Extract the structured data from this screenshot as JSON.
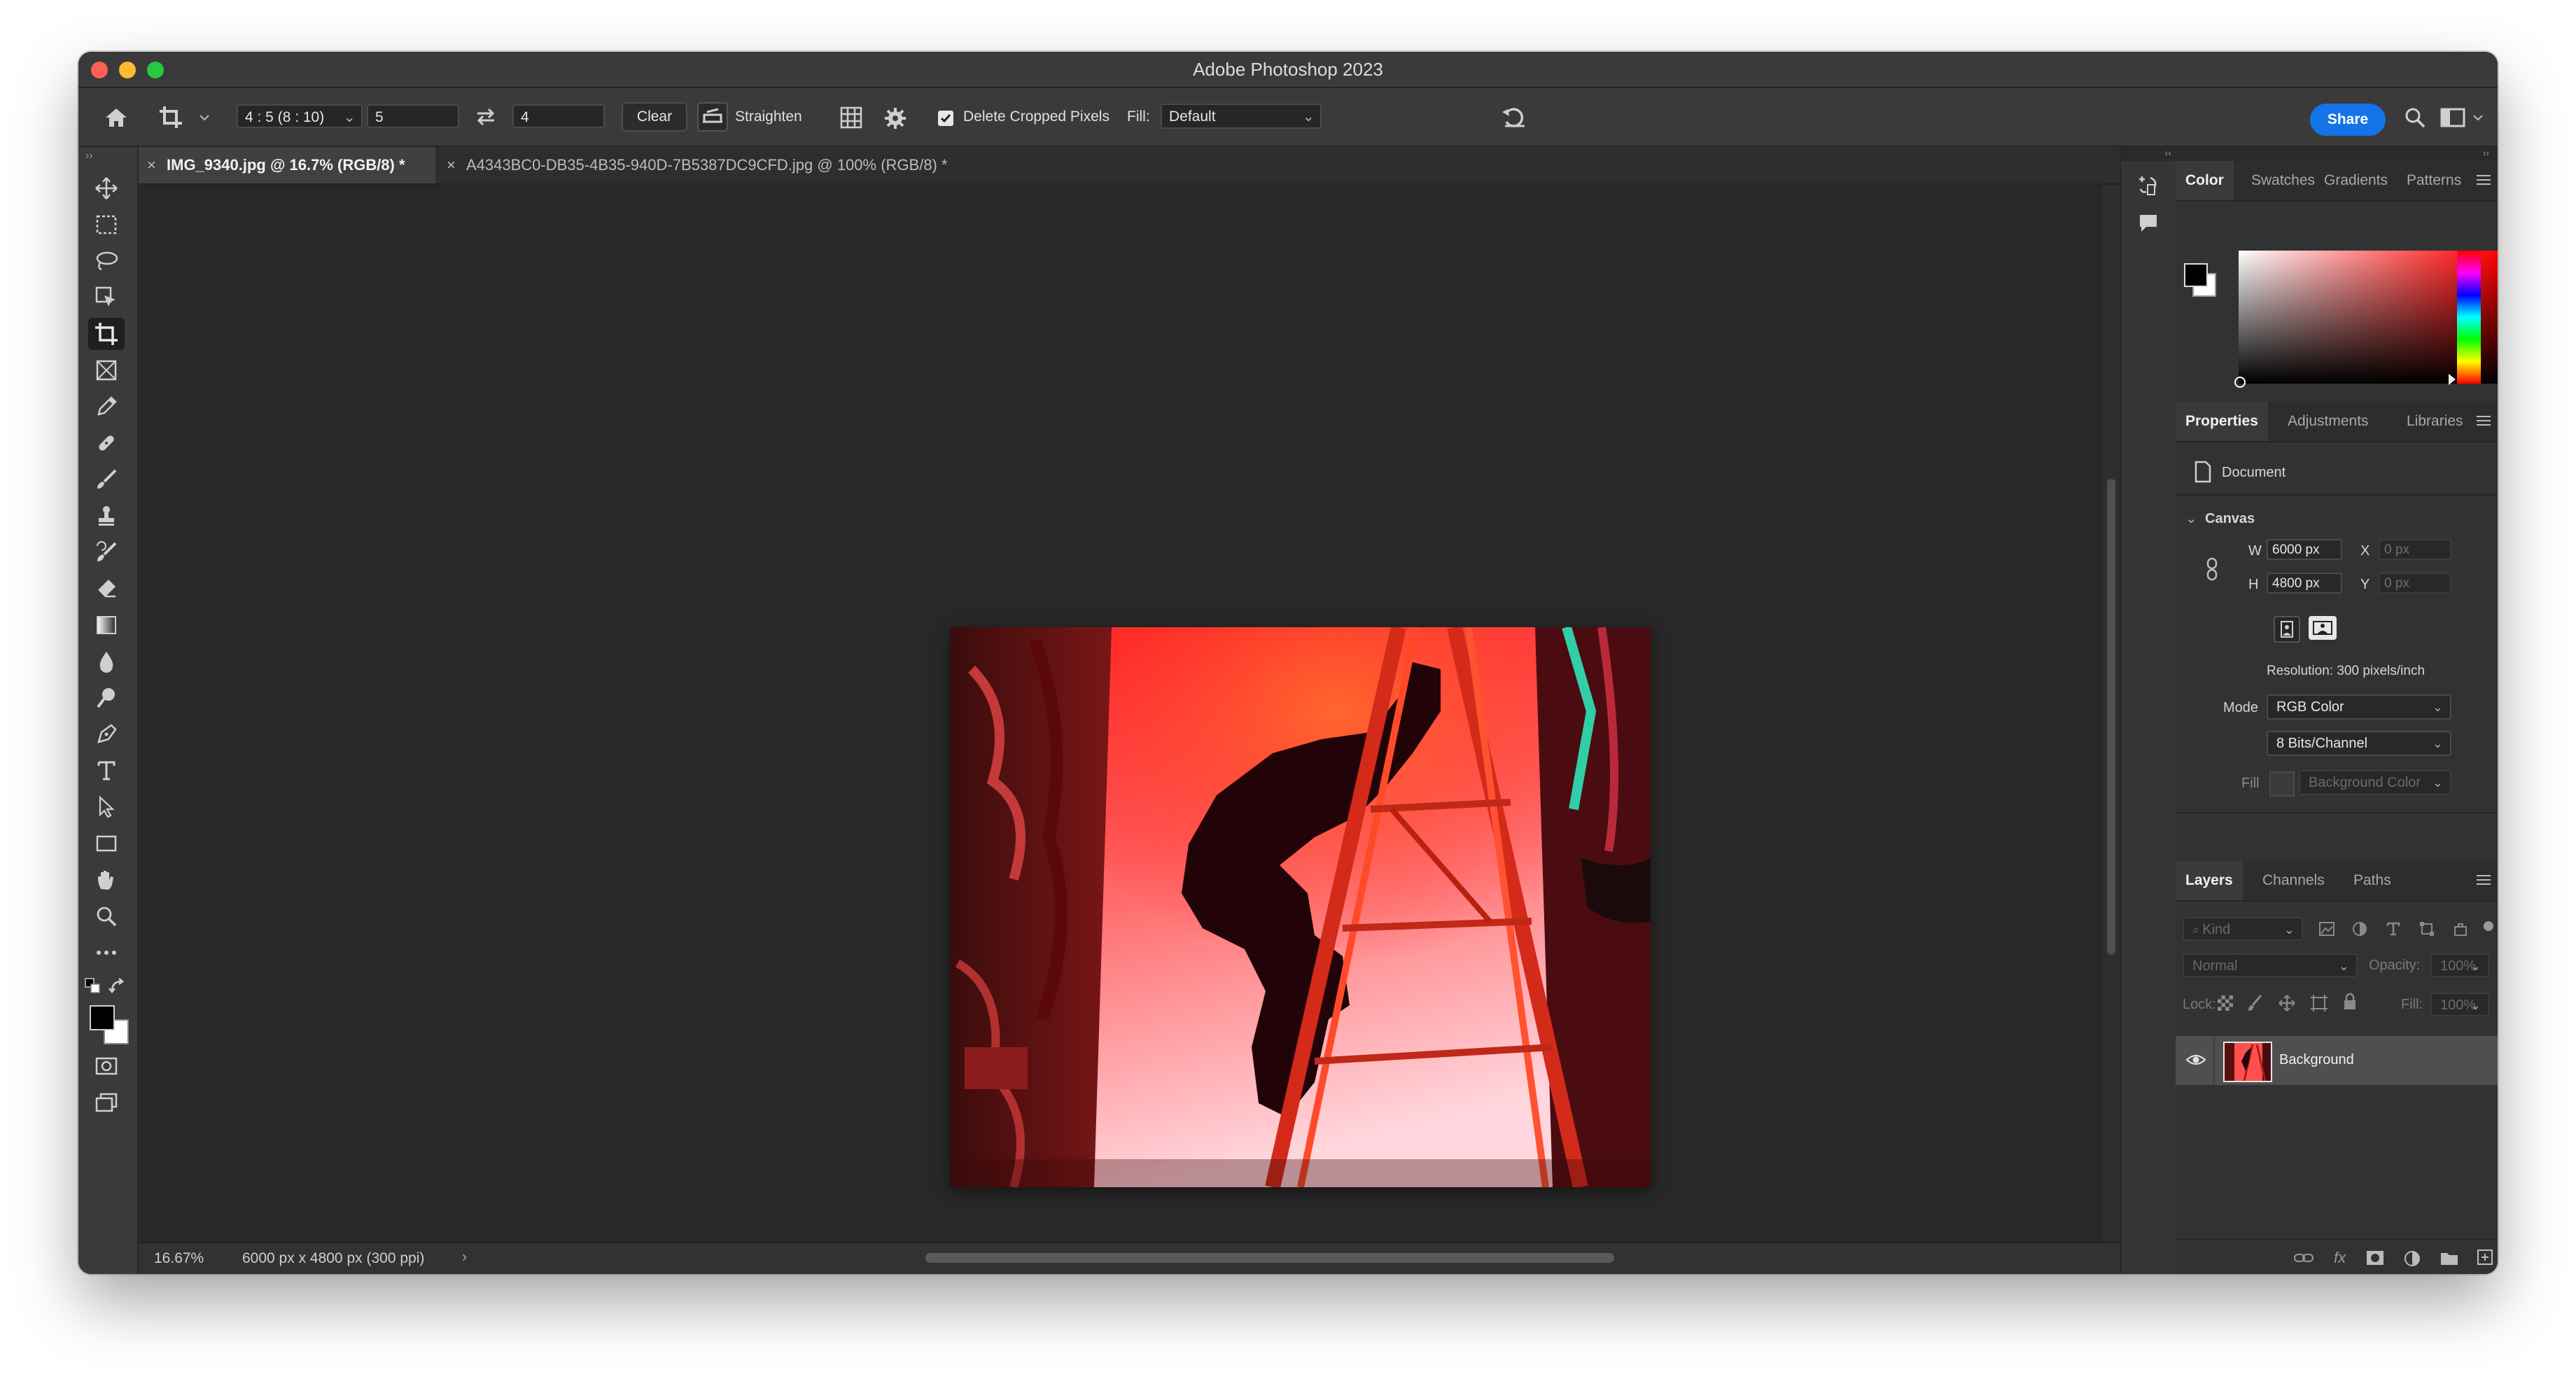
{
  "window": {
    "title": "Adobe Photoshop 2023"
  },
  "options_bar": {
    "ratio_select": "4 : 5 (8 : 10)",
    "ratio_width": "5",
    "ratio_height": "4",
    "clear_label": "Clear",
    "straighten_label": "Straighten",
    "delete_cropped_label": "Delete Cropped Pixels",
    "delete_cropped_checked": true,
    "fill_label": "Fill:",
    "fill_value": "Default",
    "share_label": "Share"
  },
  "tabs": [
    {
      "label": "IMG_9340.jpg @ 16.7% (RGB/8) *",
      "active": true
    },
    {
      "label": "A4343BC0-DB35-4B35-940D-7B5387DC9CFD.jpg @ 100% (RGB/8) *",
      "active": false
    }
  ],
  "status": {
    "zoom": "16.67%",
    "doc_info": "6000 px x 4800 px (300 ppi)"
  },
  "color_panel": {
    "tabs": [
      "Color",
      "Swatches",
      "Gradients",
      "Patterns"
    ],
    "active_tab": "Color",
    "foreground": "#000000",
    "background": "#ffffff",
    "hue_color": "#ff0000"
  },
  "properties_panel": {
    "tabs": [
      "Properties",
      "Adjustments",
      "Libraries"
    ],
    "active_tab": "Properties",
    "doc_label": "Document",
    "canvas_section": "Canvas",
    "w_label": "W",
    "w_value": "6000 px",
    "h_label": "H",
    "h_value": "4800 px",
    "x_label": "X",
    "x_placeholder": "0 px",
    "y_label": "Y",
    "y_placeholder": "0 px",
    "resolution": "Resolution: 300 pixels/inch",
    "mode_label": "Mode",
    "mode_value": "RGB Color",
    "depth_value": "8 Bits/Channel",
    "fill_label": "Fill",
    "fill_value": "Background Color"
  },
  "layers_panel": {
    "tabs": [
      "Layers",
      "Channels",
      "Paths"
    ],
    "active_tab": "Layers",
    "kind_placeholder": "Kind",
    "blend_mode": "Normal",
    "opacity_label": "Opacity:",
    "opacity_value": "100%",
    "lock_label": "Lock:",
    "fill_label": "Fill:",
    "fill_value": "100%",
    "layers": [
      {
        "name": "Background",
        "visible": true,
        "locked": true
      }
    ]
  },
  "toolbar": {
    "tools": [
      "move-tool",
      "marquee-tool",
      "lasso-tool",
      "object-select-tool",
      "crop-tool",
      "frame-tool",
      "eyedropper-tool",
      "healing-tool",
      "brush-tool",
      "stamp-tool",
      "history-brush-tool",
      "eraser-tool",
      "gradient-tool",
      "blur-tool",
      "dodge-tool",
      "pen-tool",
      "type-tool",
      "path-select-tool",
      "rectangle-tool",
      "hand-tool",
      "zoom-tool",
      "more-tools"
    ],
    "active_tool": "crop-tool"
  }
}
